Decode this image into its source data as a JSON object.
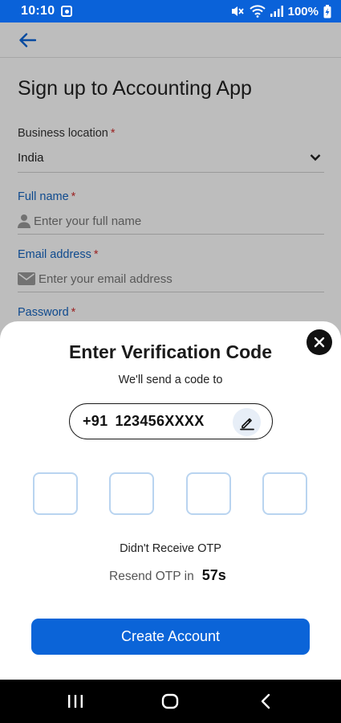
{
  "status_bar": {
    "time": "10:10",
    "battery": "100%",
    "icons": [
      "notification-icon",
      "mute-icon",
      "wifi-icon",
      "signal-icon",
      "battery-charging-icon"
    ]
  },
  "app_bar": {
    "back_icon": "arrow-left-icon"
  },
  "form": {
    "title": "Sign up to Accounting App",
    "business_location": {
      "label": "Business location",
      "required_mark": "*",
      "value": "India"
    },
    "full_name": {
      "label": "Full name",
      "required_mark": "*",
      "placeholder": "Enter your full name",
      "icon": "person-icon"
    },
    "email": {
      "label": "Email address",
      "required_mark": "*",
      "placeholder": "Enter your email address",
      "icon": "envelope-icon"
    },
    "password": {
      "label": "Password",
      "required_mark": "*"
    }
  },
  "sheet": {
    "title": "Enter Verification Code",
    "subtitle": "We'll send a code to",
    "country_code": "+91",
    "phone_number": "123456XXXX",
    "otp_digits": [
      "",
      "",
      "",
      ""
    ],
    "didnt_receive": "Didn't Receive OTP",
    "resend_label": "Resend OTP in",
    "resend_timer": "57s",
    "create_button": "Create Account"
  },
  "colors": {
    "primary": "#0b64d8",
    "status_bar": "#0a62d9",
    "required": "#d32f2f",
    "otp_border": "#b9d4f0"
  }
}
